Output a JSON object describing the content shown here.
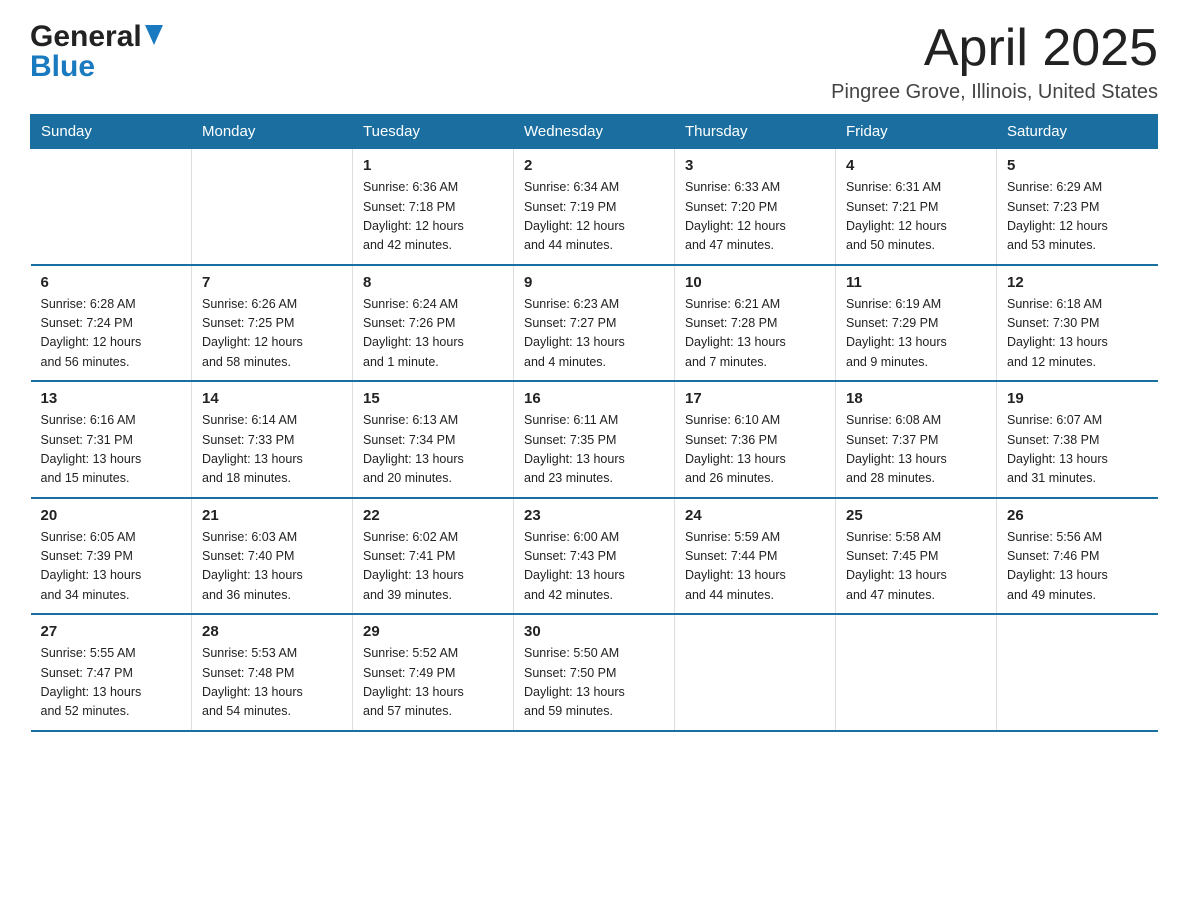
{
  "header": {
    "logo_general": "General",
    "logo_blue": "Blue",
    "title": "April 2025",
    "subtitle": "Pingree Grove, Illinois, United States"
  },
  "days_of_week": [
    "Sunday",
    "Monday",
    "Tuesday",
    "Wednesday",
    "Thursday",
    "Friday",
    "Saturday"
  ],
  "weeks": [
    [
      {
        "day": "",
        "info": ""
      },
      {
        "day": "",
        "info": ""
      },
      {
        "day": "1",
        "info": "Sunrise: 6:36 AM\nSunset: 7:18 PM\nDaylight: 12 hours\nand 42 minutes."
      },
      {
        "day": "2",
        "info": "Sunrise: 6:34 AM\nSunset: 7:19 PM\nDaylight: 12 hours\nand 44 minutes."
      },
      {
        "day": "3",
        "info": "Sunrise: 6:33 AM\nSunset: 7:20 PM\nDaylight: 12 hours\nand 47 minutes."
      },
      {
        "day": "4",
        "info": "Sunrise: 6:31 AM\nSunset: 7:21 PM\nDaylight: 12 hours\nand 50 minutes."
      },
      {
        "day": "5",
        "info": "Sunrise: 6:29 AM\nSunset: 7:23 PM\nDaylight: 12 hours\nand 53 minutes."
      }
    ],
    [
      {
        "day": "6",
        "info": "Sunrise: 6:28 AM\nSunset: 7:24 PM\nDaylight: 12 hours\nand 56 minutes."
      },
      {
        "day": "7",
        "info": "Sunrise: 6:26 AM\nSunset: 7:25 PM\nDaylight: 12 hours\nand 58 minutes."
      },
      {
        "day": "8",
        "info": "Sunrise: 6:24 AM\nSunset: 7:26 PM\nDaylight: 13 hours\nand 1 minute."
      },
      {
        "day": "9",
        "info": "Sunrise: 6:23 AM\nSunset: 7:27 PM\nDaylight: 13 hours\nand 4 minutes."
      },
      {
        "day": "10",
        "info": "Sunrise: 6:21 AM\nSunset: 7:28 PM\nDaylight: 13 hours\nand 7 minutes."
      },
      {
        "day": "11",
        "info": "Sunrise: 6:19 AM\nSunset: 7:29 PM\nDaylight: 13 hours\nand 9 minutes."
      },
      {
        "day": "12",
        "info": "Sunrise: 6:18 AM\nSunset: 7:30 PM\nDaylight: 13 hours\nand 12 minutes."
      }
    ],
    [
      {
        "day": "13",
        "info": "Sunrise: 6:16 AM\nSunset: 7:31 PM\nDaylight: 13 hours\nand 15 minutes."
      },
      {
        "day": "14",
        "info": "Sunrise: 6:14 AM\nSunset: 7:33 PM\nDaylight: 13 hours\nand 18 minutes."
      },
      {
        "day": "15",
        "info": "Sunrise: 6:13 AM\nSunset: 7:34 PM\nDaylight: 13 hours\nand 20 minutes."
      },
      {
        "day": "16",
        "info": "Sunrise: 6:11 AM\nSunset: 7:35 PM\nDaylight: 13 hours\nand 23 minutes."
      },
      {
        "day": "17",
        "info": "Sunrise: 6:10 AM\nSunset: 7:36 PM\nDaylight: 13 hours\nand 26 minutes."
      },
      {
        "day": "18",
        "info": "Sunrise: 6:08 AM\nSunset: 7:37 PM\nDaylight: 13 hours\nand 28 minutes."
      },
      {
        "day": "19",
        "info": "Sunrise: 6:07 AM\nSunset: 7:38 PM\nDaylight: 13 hours\nand 31 minutes."
      }
    ],
    [
      {
        "day": "20",
        "info": "Sunrise: 6:05 AM\nSunset: 7:39 PM\nDaylight: 13 hours\nand 34 minutes."
      },
      {
        "day": "21",
        "info": "Sunrise: 6:03 AM\nSunset: 7:40 PM\nDaylight: 13 hours\nand 36 minutes."
      },
      {
        "day": "22",
        "info": "Sunrise: 6:02 AM\nSunset: 7:41 PM\nDaylight: 13 hours\nand 39 minutes."
      },
      {
        "day": "23",
        "info": "Sunrise: 6:00 AM\nSunset: 7:43 PM\nDaylight: 13 hours\nand 42 minutes."
      },
      {
        "day": "24",
        "info": "Sunrise: 5:59 AM\nSunset: 7:44 PM\nDaylight: 13 hours\nand 44 minutes."
      },
      {
        "day": "25",
        "info": "Sunrise: 5:58 AM\nSunset: 7:45 PM\nDaylight: 13 hours\nand 47 minutes."
      },
      {
        "day": "26",
        "info": "Sunrise: 5:56 AM\nSunset: 7:46 PM\nDaylight: 13 hours\nand 49 minutes."
      }
    ],
    [
      {
        "day": "27",
        "info": "Sunrise: 5:55 AM\nSunset: 7:47 PM\nDaylight: 13 hours\nand 52 minutes."
      },
      {
        "day": "28",
        "info": "Sunrise: 5:53 AM\nSunset: 7:48 PM\nDaylight: 13 hours\nand 54 minutes."
      },
      {
        "day": "29",
        "info": "Sunrise: 5:52 AM\nSunset: 7:49 PM\nDaylight: 13 hours\nand 57 minutes."
      },
      {
        "day": "30",
        "info": "Sunrise: 5:50 AM\nSunset: 7:50 PM\nDaylight: 13 hours\nand 59 minutes."
      },
      {
        "day": "",
        "info": ""
      },
      {
        "day": "",
        "info": ""
      },
      {
        "day": "",
        "info": ""
      }
    ]
  ]
}
